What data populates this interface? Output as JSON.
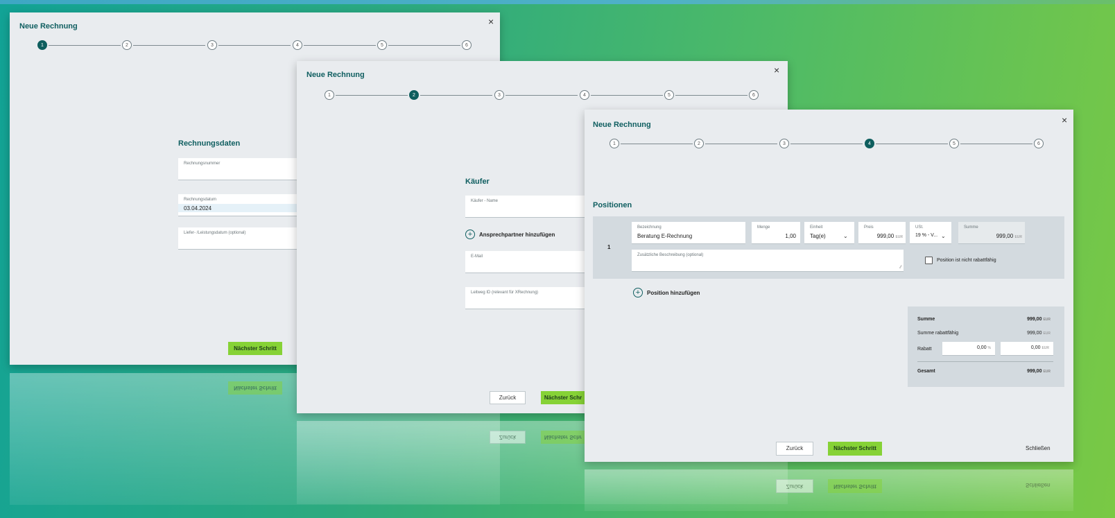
{
  "app": {
    "dialog_title": "Neue Rechnung",
    "close_glyph": "×"
  },
  "steps": [
    "1",
    "2",
    "3",
    "4",
    "5",
    "6"
  ],
  "step1": {
    "section": "Rechnungsdaten",
    "invoice_number_label": "Rechnungsnummer",
    "invoice_date_label": "Rechnungsdatum",
    "invoice_date_value": "03.04.2024",
    "delivery_date_label": "Liefer- /Leistungsdatum (optional)",
    "next_button": "Nächster Schritt"
  },
  "step2": {
    "section": "Käufer",
    "buyer_name_label": "Käufer - Name",
    "add_contact": "Ansprechpartner hinzufügen",
    "email_label": "E-Mail",
    "leitweg_label": "Leitweg ID (relevant für XRechnung)",
    "back_button": "Zurück",
    "next_button": "Nächster Schr"
  },
  "step4": {
    "section": "Positionen",
    "row_number": "1",
    "labels": {
      "description": "Bezeichnung",
      "quantity": "Menge",
      "unit": "Einheit",
      "price": "Preis",
      "vat": "USt.",
      "sum": "Summe",
      "extra_desc": "Zusätzliche Beschreibung (optional)"
    },
    "values": {
      "description": "Beratung E-Rechnung",
      "quantity": "1,00",
      "unit": "Tag(e)",
      "price": "999,00",
      "vat": "19 % - V...",
      "sum": "999,00"
    },
    "currency": "EUR",
    "no_discount_checkbox": "Position ist nicht rabattfähig",
    "add_position": "Position hinzufügen",
    "totals": {
      "sum_label": "Summe",
      "sum_value": "999,00",
      "discountable_label": "Summe rabattfähig",
      "discountable_value": "999,00",
      "discount_label": "Rabatt",
      "discount_percent": "0,00",
      "percent_unit": "%",
      "discount_amount": "0,00",
      "total_label": "Gesamt",
      "total_value": "999,00"
    },
    "back_button": "Zurück",
    "next_button": "Nächster Schritt",
    "close_button": "Schließen"
  }
}
